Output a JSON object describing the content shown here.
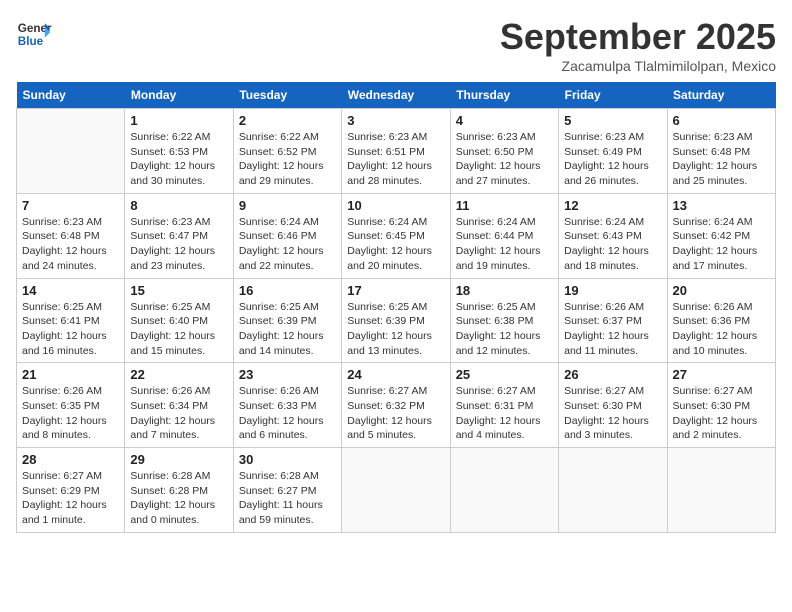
{
  "logo": {
    "line1": "General",
    "line2": "Blue"
  },
  "title": "September 2025",
  "subtitle": "Zacamulpa Tlalmimilolpan, Mexico",
  "weekdays": [
    "Sunday",
    "Monday",
    "Tuesday",
    "Wednesday",
    "Thursday",
    "Friday",
    "Saturday"
  ],
  "weeks": [
    [
      {
        "day": "",
        "info": ""
      },
      {
        "day": "1",
        "info": "Sunrise: 6:22 AM\nSunset: 6:53 PM\nDaylight: 12 hours\nand 30 minutes."
      },
      {
        "day": "2",
        "info": "Sunrise: 6:22 AM\nSunset: 6:52 PM\nDaylight: 12 hours\nand 29 minutes."
      },
      {
        "day": "3",
        "info": "Sunrise: 6:23 AM\nSunset: 6:51 PM\nDaylight: 12 hours\nand 28 minutes."
      },
      {
        "day": "4",
        "info": "Sunrise: 6:23 AM\nSunset: 6:50 PM\nDaylight: 12 hours\nand 27 minutes."
      },
      {
        "day": "5",
        "info": "Sunrise: 6:23 AM\nSunset: 6:49 PM\nDaylight: 12 hours\nand 26 minutes."
      },
      {
        "day": "6",
        "info": "Sunrise: 6:23 AM\nSunset: 6:48 PM\nDaylight: 12 hours\nand 25 minutes."
      }
    ],
    [
      {
        "day": "7",
        "info": "Sunrise: 6:23 AM\nSunset: 6:48 PM\nDaylight: 12 hours\nand 24 minutes."
      },
      {
        "day": "8",
        "info": "Sunrise: 6:23 AM\nSunset: 6:47 PM\nDaylight: 12 hours\nand 23 minutes."
      },
      {
        "day": "9",
        "info": "Sunrise: 6:24 AM\nSunset: 6:46 PM\nDaylight: 12 hours\nand 22 minutes."
      },
      {
        "day": "10",
        "info": "Sunrise: 6:24 AM\nSunset: 6:45 PM\nDaylight: 12 hours\nand 20 minutes."
      },
      {
        "day": "11",
        "info": "Sunrise: 6:24 AM\nSunset: 6:44 PM\nDaylight: 12 hours\nand 19 minutes."
      },
      {
        "day": "12",
        "info": "Sunrise: 6:24 AM\nSunset: 6:43 PM\nDaylight: 12 hours\nand 18 minutes."
      },
      {
        "day": "13",
        "info": "Sunrise: 6:24 AM\nSunset: 6:42 PM\nDaylight: 12 hours\nand 17 minutes."
      }
    ],
    [
      {
        "day": "14",
        "info": "Sunrise: 6:25 AM\nSunset: 6:41 PM\nDaylight: 12 hours\nand 16 minutes."
      },
      {
        "day": "15",
        "info": "Sunrise: 6:25 AM\nSunset: 6:40 PM\nDaylight: 12 hours\nand 15 minutes."
      },
      {
        "day": "16",
        "info": "Sunrise: 6:25 AM\nSunset: 6:39 PM\nDaylight: 12 hours\nand 14 minutes."
      },
      {
        "day": "17",
        "info": "Sunrise: 6:25 AM\nSunset: 6:39 PM\nDaylight: 12 hours\nand 13 minutes."
      },
      {
        "day": "18",
        "info": "Sunrise: 6:25 AM\nSunset: 6:38 PM\nDaylight: 12 hours\nand 12 minutes."
      },
      {
        "day": "19",
        "info": "Sunrise: 6:26 AM\nSunset: 6:37 PM\nDaylight: 12 hours\nand 11 minutes."
      },
      {
        "day": "20",
        "info": "Sunrise: 6:26 AM\nSunset: 6:36 PM\nDaylight: 12 hours\nand 10 minutes."
      }
    ],
    [
      {
        "day": "21",
        "info": "Sunrise: 6:26 AM\nSunset: 6:35 PM\nDaylight: 12 hours\nand 8 minutes."
      },
      {
        "day": "22",
        "info": "Sunrise: 6:26 AM\nSunset: 6:34 PM\nDaylight: 12 hours\nand 7 minutes."
      },
      {
        "day": "23",
        "info": "Sunrise: 6:26 AM\nSunset: 6:33 PM\nDaylight: 12 hours\nand 6 minutes."
      },
      {
        "day": "24",
        "info": "Sunrise: 6:27 AM\nSunset: 6:32 PM\nDaylight: 12 hours\nand 5 minutes."
      },
      {
        "day": "25",
        "info": "Sunrise: 6:27 AM\nSunset: 6:31 PM\nDaylight: 12 hours\nand 4 minutes."
      },
      {
        "day": "26",
        "info": "Sunrise: 6:27 AM\nSunset: 6:30 PM\nDaylight: 12 hours\nand 3 minutes."
      },
      {
        "day": "27",
        "info": "Sunrise: 6:27 AM\nSunset: 6:30 PM\nDaylight: 12 hours\nand 2 minutes."
      }
    ],
    [
      {
        "day": "28",
        "info": "Sunrise: 6:27 AM\nSunset: 6:29 PM\nDaylight: 12 hours\nand 1 minute."
      },
      {
        "day": "29",
        "info": "Sunrise: 6:28 AM\nSunset: 6:28 PM\nDaylight: 12 hours\nand 0 minutes."
      },
      {
        "day": "30",
        "info": "Sunrise: 6:28 AM\nSunset: 6:27 PM\nDaylight: 11 hours\nand 59 minutes."
      },
      {
        "day": "",
        "info": ""
      },
      {
        "day": "",
        "info": ""
      },
      {
        "day": "",
        "info": ""
      },
      {
        "day": "",
        "info": ""
      }
    ]
  ]
}
